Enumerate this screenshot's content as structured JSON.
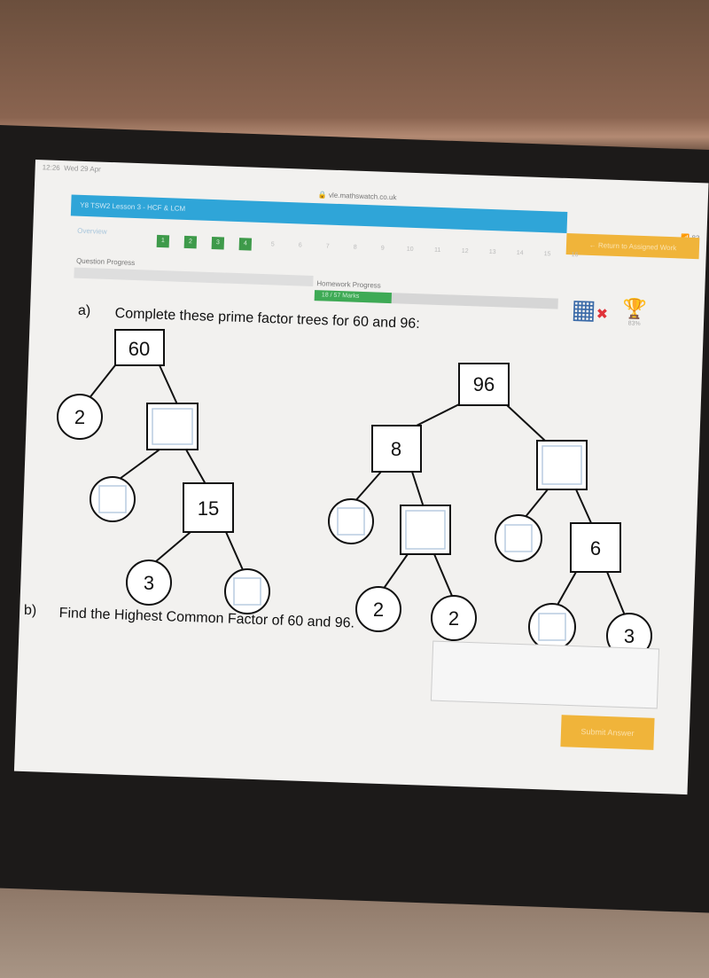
{
  "status_bar": {
    "time": "12:26",
    "date": "Wed 29 Apr",
    "battery": "83"
  },
  "browser": {
    "url": "vle.mathswatch.co.uk"
  },
  "header": {
    "title": "Y8 TSW2 Lesson 3 - HCF & LCM",
    "return_button": "← Return to Assigned Work",
    "overview_link": "Overview"
  },
  "questions": {
    "items": [
      "1",
      "2",
      "3",
      "4",
      "5",
      "6",
      "7",
      "8",
      "9",
      "10",
      "11",
      "12",
      "13",
      "14",
      "15",
      "16"
    ],
    "completed": 4
  },
  "progress": {
    "question_label": "Question Progress",
    "homework_label": "Homework Progress",
    "homework_value": "18 / 57 Marks",
    "homework_fraction": 0.316
  },
  "tools": {
    "calculator_icon": "calculator-disabled-icon",
    "trophy_icon": "trophy-icon",
    "trophy_value": "83%"
  },
  "part_a": {
    "label": "a)",
    "text": "Complete these prime factor trees for 60 and 96:"
  },
  "tree60": {
    "root": "60",
    "n1": "2",
    "n2": "",
    "n3": "",
    "n4": "15",
    "n5": "3",
    "n6": ""
  },
  "tree96": {
    "root": "96",
    "n1": "8",
    "n2": "",
    "n3": "",
    "n4": "",
    "n5": "2",
    "n6": "2",
    "n7": "",
    "n8": "6",
    "n9": "",
    "n10": "3"
  },
  "part_b": {
    "label": "b)",
    "text": "Find the Highest Common Factor of 60 and 96.",
    "answer": ""
  },
  "submit_button": "Submit Answer",
  "colors": {
    "header_blue": "#2fa5d8",
    "accent_orange": "#f0b43a",
    "progress_green": "#3eaa55"
  }
}
